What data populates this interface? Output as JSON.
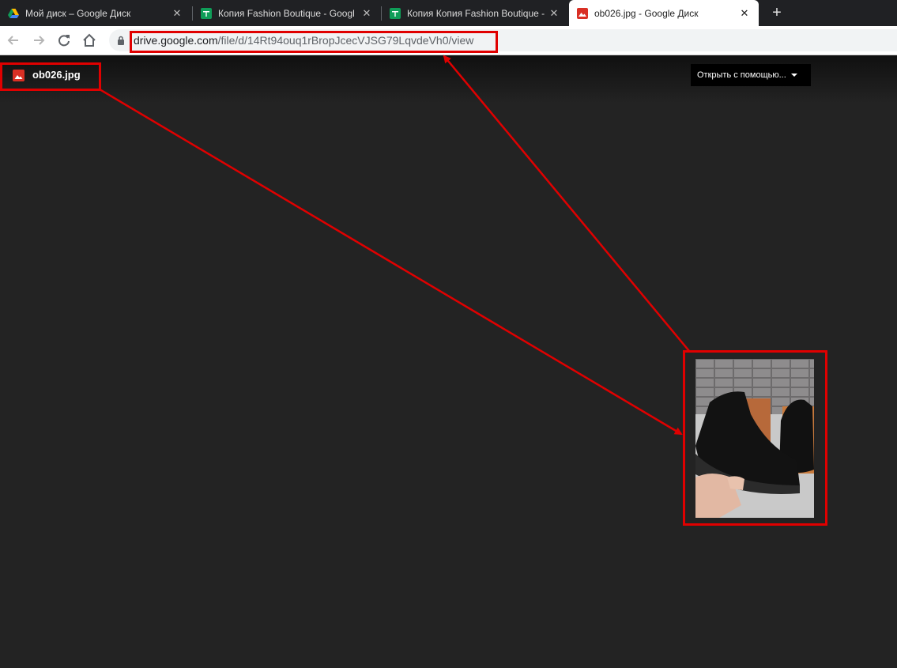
{
  "browser": {
    "tabs": [
      {
        "title": "Мой диск – Google Диск",
        "icon": "google-drive-icon",
        "active": false
      },
      {
        "title": "Копия Fashion Boutique - Googl",
        "icon": "google-sheets-icon",
        "active": false
      },
      {
        "title": "Копия Копия Fashion Boutique -",
        "icon": "google-sheets-icon",
        "active": false
      },
      {
        "title": "ob026.jpg - Google Диск",
        "icon": "image-file-icon",
        "active": true
      }
    ],
    "new_tab_label": "+",
    "close_label": "✕",
    "address": {
      "domain": "drive.google.com",
      "path": "/file/d/14Rt94ouq1rBropJcecVJSG79LqvdeVh0/view"
    }
  },
  "viewer": {
    "file_name": "ob026.jpg",
    "open_with_label": "Открыть с помощью...",
    "image_subject": "black-suede-high-top-sneakers-photo"
  },
  "colors": {
    "highlight": "#e00000",
    "viewer_bg": "#232323",
    "file_icon": "#d93025"
  }
}
